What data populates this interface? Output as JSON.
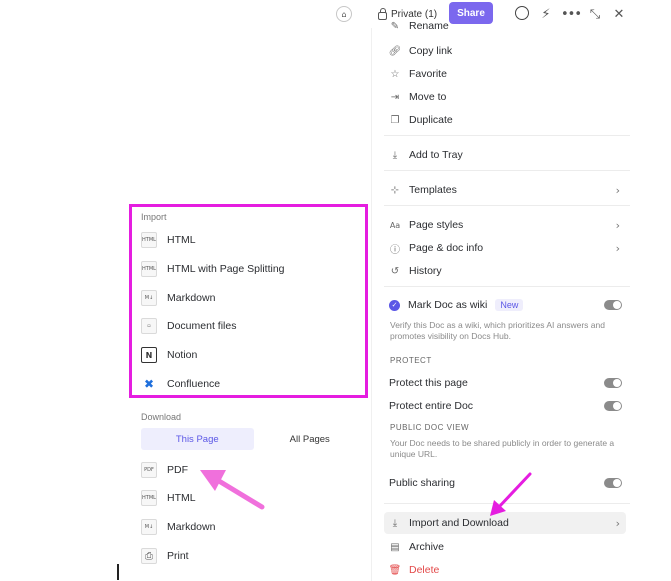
{
  "toolbar": {
    "privacy_label": "Private (1)",
    "share_label": "Share",
    "icons": [
      "tag-icon",
      "lock-icon",
      "comment-icon",
      "magic-wand-icon",
      "more-icon",
      "collapse-icon",
      "close-icon"
    ]
  },
  "menu": {
    "partial_top_label": "Rename",
    "items": [
      {
        "label": "Copy link",
        "icon": "link-icon"
      },
      {
        "label": "Favorite",
        "icon": "star-icon"
      },
      {
        "label": "Move to",
        "icon": "move-icon"
      },
      {
        "label": "Duplicate",
        "icon": "duplicate-icon"
      },
      {
        "label": "Add to Tray",
        "icon": "tray-icon"
      },
      {
        "label": "Templates",
        "icon": "templates-icon"
      },
      {
        "label": "Page styles",
        "icon": "text-style-icon"
      },
      {
        "label": "Page & doc info",
        "icon": "info-icon"
      },
      {
        "label": "History",
        "icon": "history-icon"
      }
    ],
    "wiki": {
      "label": "Mark Doc as wiki",
      "badge": "New",
      "description": "Verify this Doc as a wiki, which prioritizes AI answers and promotes visibility on Docs Hub."
    },
    "protect": {
      "section_label": "PROTECT",
      "page_label": "Protect this page",
      "doc_label": "Protect entire Doc"
    },
    "public": {
      "section_label": "PUBLIC DOC VIEW",
      "description": "Your Doc needs to be shared publicly in order to generate a unique URL.",
      "sharing_label": "Public sharing"
    },
    "bottom_items": [
      {
        "label": "Import and Download",
        "icon": "download-icon"
      },
      {
        "label": "Archive",
        "icon": "archive-icon"
      },
      {
        "label": "Delete",
        "icon": "trash-icon"
      }
    ]
  },
  "submenu": {
    "import_label": "Import",
    "import_items": [
      {
        "label": "HTML",
        "icon": "html-file-icon",
        "icon_text": "HTML"
      },
      {
        "label": "HTML with Page Splitting",
        "icon": "html-file-icon",
        "icon_text": "HTML"
      },
      {
        "label": "Markdown",
        "icon": "markdown-icon",
        "icon_text": "M↓"
      },
      {
        "label": "Document files",
        "icon": "document-icon",
        "icon_text": ""
      },
      {
        "label": "Notion",
        "icon": "notion-icon",
        "icon_text": "N"
      },
      {
        "label": "Confluence",
        "icon": "confluence-icon",
        "icon_text": "✖"
      }
    ],
    "download_label": "Download",
    "tabs": [
      "This Page",
      "All Pages"
    ],
    "download_items": [
      {
        "label": "PDF",
        "icon": "pdf-icon",
        "icon_text": "PDF"
      },
      {
        "label": "HTML",
        "icon": "html-file-icon",
        "icon_text": "HTML"
      },
      {
        "label": "Markdown",
        "icon": "markdown-icon",
        "icon_text": "M↓"
      },
      {
        "label": "Print",
        "icon": "print-icon",
        "icon_text": "⎙"
      }
    ]
  },
  "colors": {
    "accent": "#7b68ee",
    "highlight": "#e51de0",
    "danger": "#e34a4a"
  }
}
